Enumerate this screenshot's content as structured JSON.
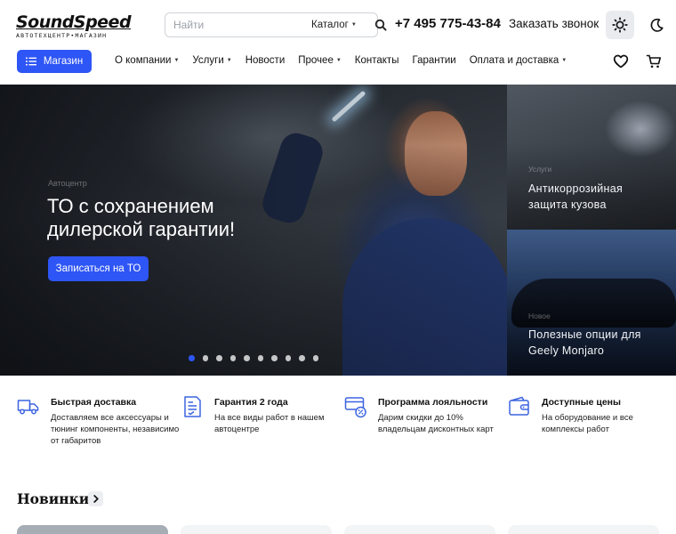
{
  "header": {
    "logo_text": "SoundSpeed",
    "logo_subtext": "АВТОТЕХЦЕНТР•МАГАЗИН",
    "search": {
      "placeholder": "Найти",
      "catalog_label": "Каталог"
    },
    "phone": "+7 495 775-43-84",
    "separator": "•",
    "callback_label": "Заказать звонок"
  },
  "nav": {
    "shop_label": "Магазин",
    "items": [
      {
        "label": "О компании",
        "has_dropdown": true
      },
      {
        "label": "Услуги",
        "has_dropdown": true
      },
      {
        "label": "Новости",
        "has_dropdown": false
      },
      {
        "label": "Прочее",
        "has_dropdown": true
      },
      {
        "label": "Контакты",
        "has_dropdown": false
      },
      {
        "label": "Гарантии",
        "has_dropdown": false
      },
      {
        "label": "Оплата и доставка",
        "has_dropdown": true
      }
    ]
  },
  "hero": {
    "subtitle": "Автоцентр",
    "title": "ТО с сохранением дилерской гарантии!",
    "button_label": "Записаться на ТО",
    "slides_count": 10,
    "active_slide": 1
  },
  "side_cards": [
    {
      "tag": "Услуги",
      "title": "Антикоррозийная защита кузова"
    },
    {
      "tag": "Новое",
      "title": "Полезные опции для Geely Monjaro"
    }
  ],
  "features": [
    {
      "icon": "delivery-truck-icon",
      "title": "Быстрая доставка",
      "text": "Доставляем все аксессуары и тюнинг компоненты, независимо от габаритов"
    },
    {
      "icon": "guarantee-document-icon",
      "title": "Гарантия 2 года",
      "text": "На все виды работ в нашем автоцентре"
    },
    {
      "icon": "loyalty-card-icon",
      "title": "Программа лояльности",
      "text": "Дарим скидки до 10% владельцам дисконтных карт"
    },
    {
      "icon": "wallet-icon",
      "title": "Доступные цены",
      "text": "На оборудование и все комплексы работ"
    }
  ],
  "section": {
    "title": "Новинки"
  },
  "colors": {
    "accent": "#2e55f5",
    "icon_blue": "#3b63e0"
  }
}
